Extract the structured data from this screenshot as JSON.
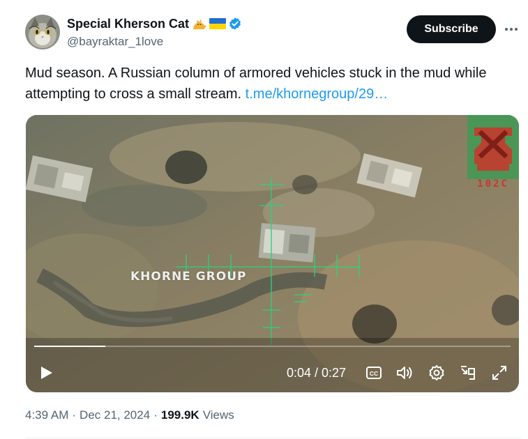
{
  "author": {
    "display_name": "Special Kherson Cat",
    "handle": "@bayraktar_1love",
    "badges": [
      "cat-emoji",
      "ukraine-flag-emoji",
      "verified-badge"
    ],
    "verified_color": "#1d9bf0"
  },
  "actions": {
    "subscribe_label": "Subscribe",
    "more_icon": "more-horizontal-icon"
  },
  "tweet": {
    "text": "Mud season. A Russian column of armored vehicles stuck in the mud while attempting to cross a small stream. ",
    "link_text": "t.me/khornegroup/29…",
    "link_color": "#1d9bf0"
  },
  "media": {
    "type": "video",
    "watermark": "KHORNE GROUP",
    "logo_text": "102C",
    "current_time": "0:04",
    "duration": "0:27",
    "time_display": "0:04 / 0:27",
    "progress_fraction": 0.15,
    "controls": [
      "play-icon",
      "captions-icon",
      "volume-icon",
      "settings-icon",
      "pip-icon",
      "fullscreen-icon"
    ]
  },
  "meta": {
    "time": "4:39 AM",
    "date": "Dec 21, 2024",
    "separator": "·",
    "views_count": "199.9K",
    "views_label": "Views"
  },
  "colors": {
    "text_primary": "#0f1419",
    "text_secondary": "#536471",
    "accent": "#1d9bf0",
    "button_dark": "#0f1419"
  }
}
